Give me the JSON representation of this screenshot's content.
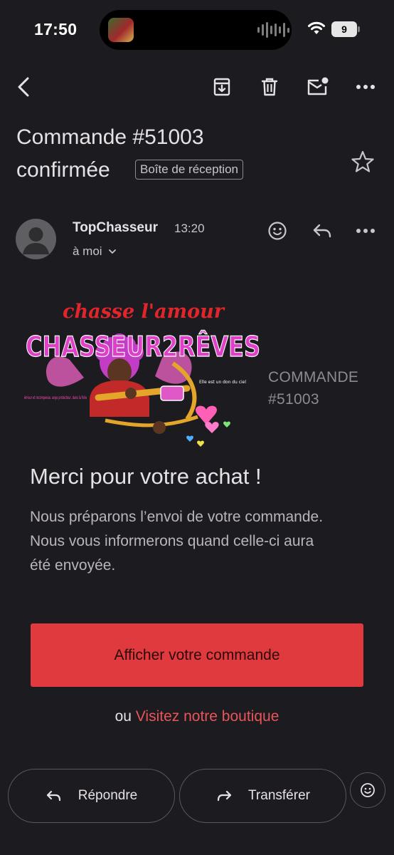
{
  "status_bar": {
    "time": "17:50",
    "battery": "9"
  },
  "toolbar": {
    "back_icon": "chevron-left-icon",
    "archive_icon": "archive-icon",
    "delete_icon": "trash-icon",
    "mark_unread_icon": "mark-unread-icon",
    "more_icon": "more-horizontal-icon"
  },
  "email": {
    "subject_line1": "Commande #51003",
    "subject_line2": "confirmée",
    "label": "Boîte de réception",
    "sender": "TopChasseur",
    "time": "13:20",
    "recipient": "à moi"
  },
  "content": {
    "banner": {
      "script_text": "chasse l'amour",
      "title": "CHASSEUR2RÊVES",
      "side_caption": "Amour et recompense, ange protecteur, dans la folie",
      "heart_caption": "Elle est un don du ciel"
    },
    "order_label_line1": "COMMANDE",
    "order_label_line2": "#51003",
    "thanks": "Merci pour votre achat !",
    "message": "Nous préparons l’envoi de votre commande. Nous vous informerons quand celle-ci aura été envoyée.",
    "cta_label": "Afficher votre commande",
    "alt_prefix": "ou",
    "alt_link": "Visitez notre boutique"
  },
  "footer": {
    "reply_label": "Répondre",
    "forward_label": "Transférer"
  },
  "colors": {
    "background": "#1c1b1f",
    "cta": "#e03a3e",
    "link": "#e8555a",
    "banner_pink": "#e040c8",
    "banner_red": "#e0262b"
  }
}
